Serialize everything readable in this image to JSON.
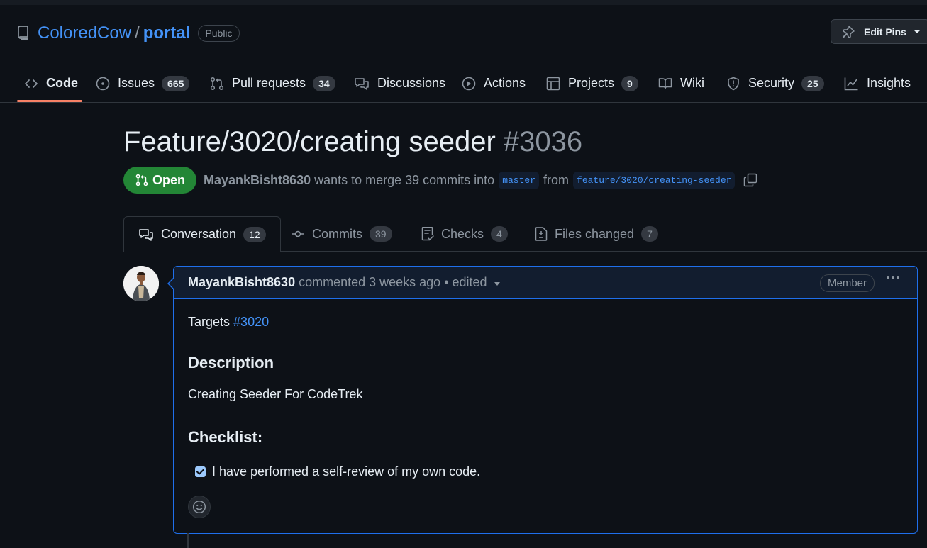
{
  "repo": {
    "owner": "ColoredCow",
    "separator": "/",
    "name": "portal",
    "visibility": "Public",
    "icon": "repo-icon"
  },
  "edit_pins": {
    "label": "Edit Pins",
    "icon": "pin-icon"
  },
  "nav": {
    "code": {
      "label": "Code"
    },
    "issues": {
      "label": "Issues",
      "count": "665"
    },
    "pulls": {
      "label": "Pull requests",
      "count": "34"
    },
    "discussions": {
      "label": "Discussions"
    },
    "actions": {
      "label": "Actions"
    },
    "projects": {
      "label": "Projects",
      "count": "9"
    },
    "wiki": {
      "label": "Wiki"
    },
    "security": {
      "label": "Security",
      "count": "25"
    },
    "insights": {
      "label": "Insights"
    }
  },
  "pr": {
    "title": "Feature/3020/creating seeder",
    "number": "#3036",
    "state": "Open",
    "author": "MayankBisht8630",
    "merge_text": "wants to merge 39 commits into",
    "base_branch": "master",
    "from_text": "from",
    "head_branch": "feature/3020/creating-seeder"
  },
  "tabs": {
    "conversation": {
      "label": "Conversation",
      "count": "12"
    },
    "commits": {
      "label": "Commits",
      "count": "39"
    },
    "checks": {
      "label": "Checks",
      "count": "4"
    },
    "files": {
      "label": "Files changed",
      "count": "7"
    }
  },
  "comment": {
    "author": "MayankBisht8630",
    "meta": "commented 3 weeks ago • edited",
    "role": "Member",
    "targets_prefix": "Targets",
    "targets_link": "#3020",
    "description_heading": "Description",
    "description_text": "Creating Seeder For CodeTrek",
    "checklist_heading": "Checklist:",
    "checklist_item": "I have performed a self-review of my own code.",
    "checklist_checked": true
  },
  "colors": {
    "background": "#0d1117",
    "accent": "#4493f8",
    "open_green": "#238636",
    "active_underline": "#f78166",
    "comment_border": "#1f6feb"
  }
}
